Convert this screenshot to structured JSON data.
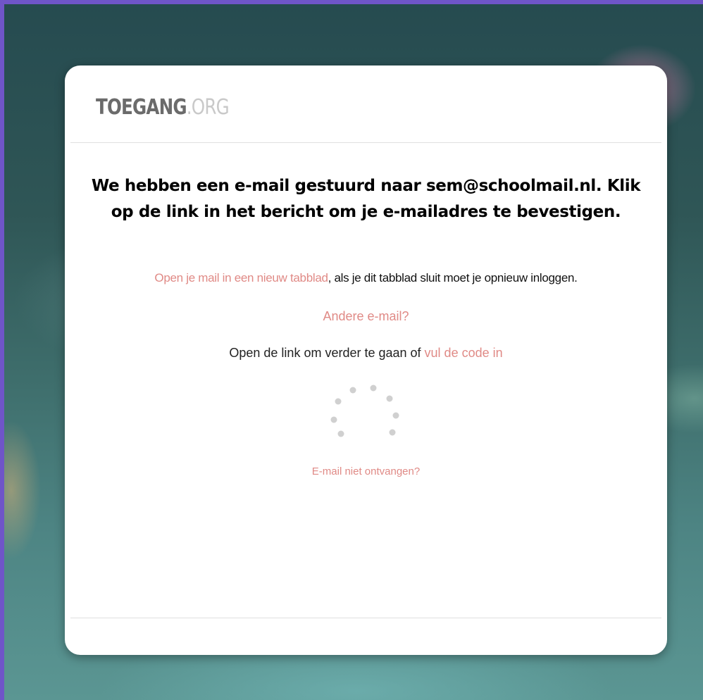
{
  "brand": {
    "name": "TOEGANG",
    "tld": ".ORG"
  },
  "message": {
    "headline": "We hebben een e-mail gestuurd naar sem@schoolmail.nl. Klik op de link in het bericht om je e-mailadres te bevestigen."
  },
  "hint": {
    "link_text": "Open je mail in een nieuw tabblad",
    "rest_text": ", als je dit tabblad sluit moet je opnieuw inloggen."
  },
  "actions": {
    "other_email": "Andere e-mail?",
    "continue_prefix": "Open de link om verder te gaan of ",
    "enter_code": "vul de code in",
    "not_received": "E-mail niet ontvangen?"
  },
  "colors": {
    "accent": "#e08a86",
    "spinner_dot": "#d0d0d0"
  },
  "status": {
    "loading": true
  }
}
